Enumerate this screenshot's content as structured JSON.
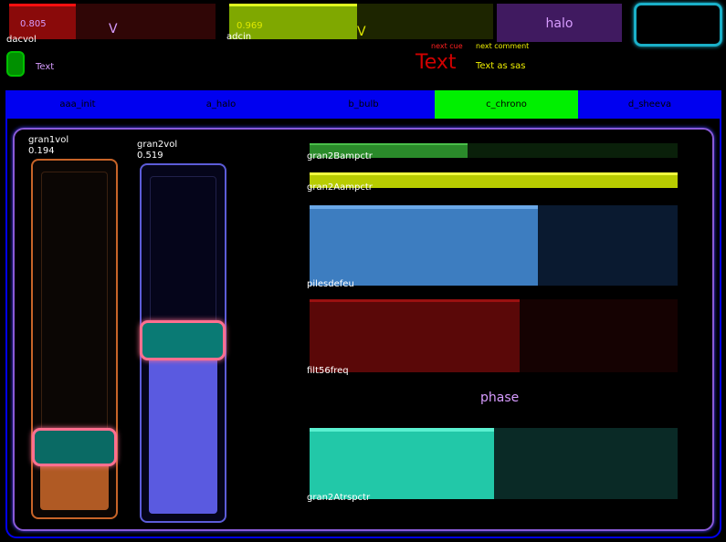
{
  "top": {
    "dacvol": {
      "label": "dacvol",
      "value": "0.805",
      "letter": "V",
      "fraction": 0.805,
      "color": "#ff0000"
    },
    "adcin": {
      "label": "adcin",
      "value": "0.969",
      "letter": "V",
      "fraction": 0.969,
      "color": "#c8ff00"
    },
    "halo_button": {
      "label": "halo",
      "color": "#401a60",
      "text_color": "#d79cff"
    },
    "empty_box": {
      "color": "#1ab0c8"
    },
    "toggle": {
      "label": "Text",
      "color": "#00e000"
    },
    "cue": {
      "next_cue_label": "next cue",
      "cue_text": "Text",
      "next_comment_label": "next comment",
      "comment_text": "Text as sas"
    }
  },
  "tabs": [
    {
      "label": "aaa_init",
      "active": false
    },
    {
      "label": "a_halo",
      "active": false
    },
    {
      "label": "b_bulb",
      "active": false
    },
    {
      "label": "c_chrono",
      "active": true
    },
    {
      "label": "d_sheeva",
      "active": false
    }
  ],
  "panel": {
    "vsliders": [
      {
        "label": "gran1vol",
        "value": "0.194",
        "fraction": 0.194,
        "color": "#c86428"
      },
      {
        "label": "gran2vol",
        "value": "0.519",
        "fraction": 0.519,
        "color": "#5c5cd8"
      }
    ],
    "hsliders": [
      {
        "label": "gran2Bampctr",
        "fraction": 0.43,
        "color": "#2a8a2a"
      },
      {
        "label": "gran2Aampctr",
        "fraction": 1.0,
        "color": "#d7ee00"
      },
      {
        "label": "pilesdefeu",
        "fraction": 0.62,
        "color": "#3d7dc0"
      },
      {
        "label": "filt56freq",
        "fraction": 0.57,
        "color": "#7a0a0a"
      },
      {
        "label": "gran2Atrspctr",
        "fraction": 0.5,
        "color": "#22c8a8"
      }
    ],
    "phase_label": "phase"
  }
}
